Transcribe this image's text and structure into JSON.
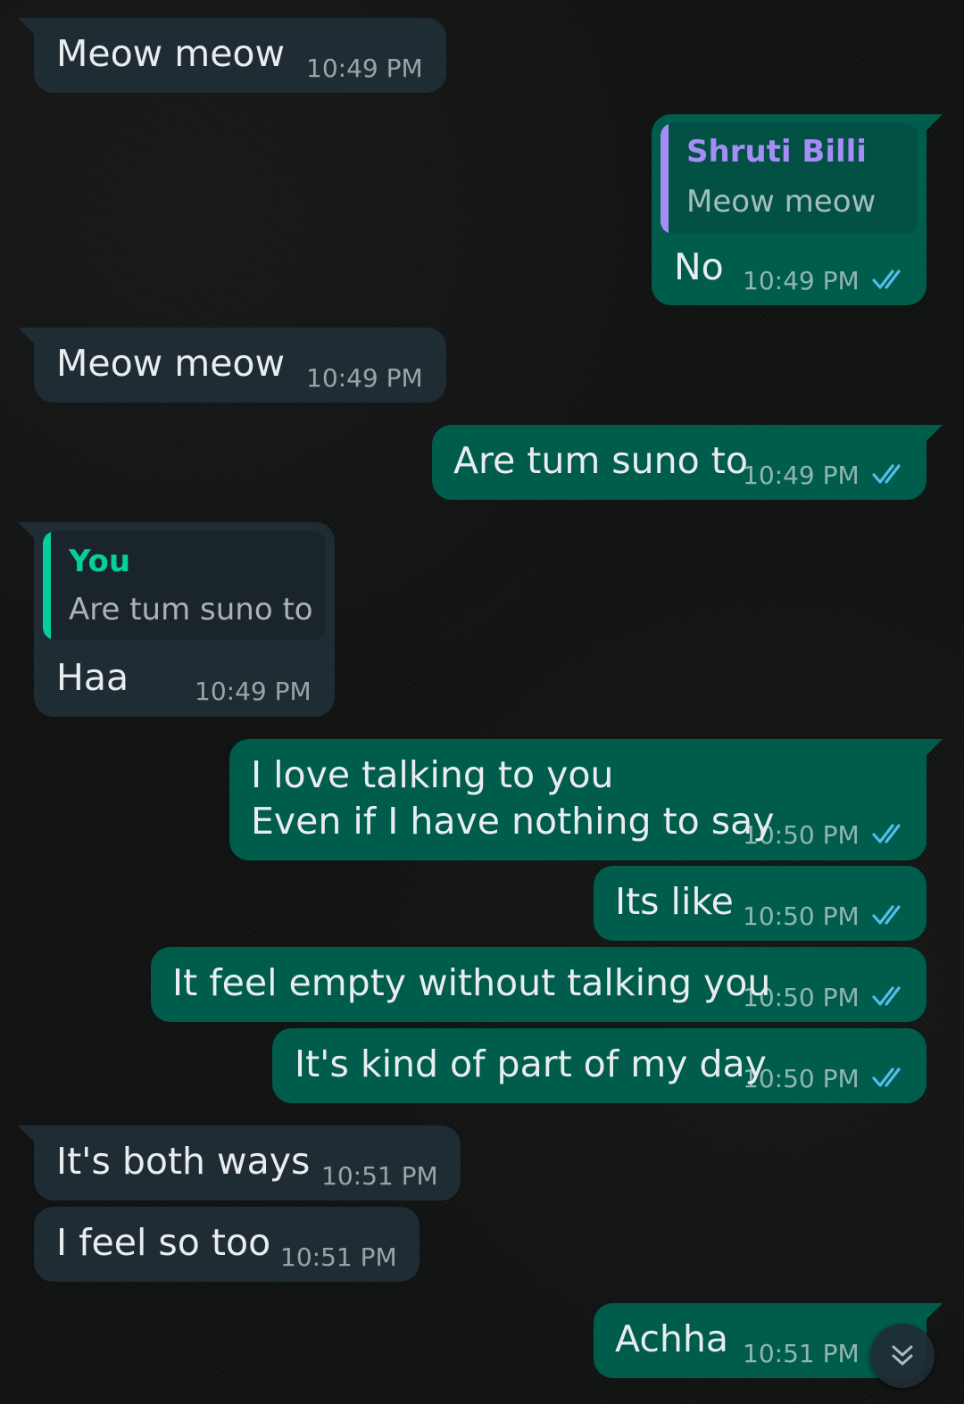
{
  "colors": {
    "incoming_bubble": "#202c33",
    "outgoing_bubble": "#005c4b",
    "read_ticks": "#53bdeb",
    "quote_name_other": "#a48df5",
    "quote_name_you": "#06cf9c"
  },
  "messages": [
    {
      "direction": "in",
      "text": "Meow meow",
      "time": "10:49 PM"
    },
    {
      "direction": "out",
      "text": "No",
      "time": "10:49 PM",
      "status": "read",
      "reply_to": {
        "name": "Shruti Billi",
        "text": "Meow meow"
      }
    },
    {
      "direction": "in",
      "text": "Meow meow",
      "time": "10:49 PM"
    },
    {
      "direction": "out",
      "text": "Are tum suno to",
      "time": "10:49 PM",
      "status": "read"
    },
    {
      "direction": "in",
      "text": "Haa",
      "time": "10:49 PM",
      "reply_to": {
        "name": "You",
        "text": "Are tum suno to"
      }
    },
    {
      "direction": "out",
      "lines": [
        "I love talking to you",
        "Even if I have nothing to say"
      ],
      "time": "10:50 PM",
      "status": "read"
    },
    {
      "direction": "out",
      "text": "Its like",
      "time": "10:50 PM",
      "status": "read"
    },
    {
      "direction": "out",
      "text": "It feel empty without talking you",
      "time": "10:50 PM",
      "status": "read"
    },
    {
      "direction": "out",
      "text": "It's kind of part of my day",
      "time": "10:50 PM",
      "status": "read"
    },
    {
      "direction": "in",
      "text": "It's both ways",
      "time": "10:51 PM"
    },
    {
      "direction": "in",
      "text": "I feel so too",
      "time": "10:51 PM"
    },
    {
      "direction": "out",
      "text": "Achha",
      "time": "10:51 PM",
      "status": "read"
    }
  ],
  "scroll_button": {
    "icon": "double-chevron-down-icon"
  }
}
